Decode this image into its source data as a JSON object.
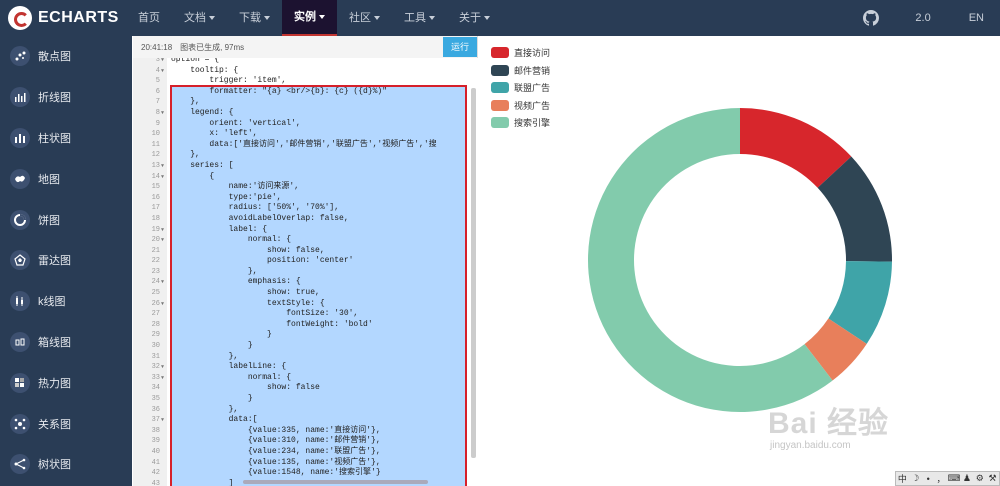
{
  "nav": {
    "logo_text": "ECHARTS",
    "items": [
      {
        "label": "首页",
        "caret": false,
        "active": false
      },
      {
        "label": "文档",
        "caret": true,
        "active": false
      },
      {
        "label": "下载",
        "caret": true,
        "active": false
      },
      {
        "label": "实例",
        "caret": true,
        "active": true
      },
      {
        "label": "社区",
        "caret": true,
        "active": false
      },
      {
        "label": "工具",
        "caret": true,
        "active": false
      },
      {
        "label": "关于",
        "caret": true,
        "active": false
      }
    ],
    "version": "2.0",
    "lang": "EN",
    "github_icon": "github-icon"
  },
  "sidebar": {
    "items": [
      {
        "label": "散点图",
        "icon": "scatter-icon"
      },
      {
        "label": "折线图",
        "icon": "line-chart-icon"
      },
      {
        "label": "柱状图",
        "icon": "bar-chart-icon"
      },
      {
        "label": "地图",
        "icon": "map-icon"
      },
      {
        "label": "饼图",
        "icon": "pie-icon"
      },
      {
        "label": "雷达图",
        "icon": "radar-icon"
      },
      {
        "label": "k线图",
        "icon": "candlestick-icon"
      },
      {
        "label": "箱线图",
        "icon": "boxplot-icon"
      },
      {
        "label": "热力图",
        "icon": "heatmap-icon"
      },
      {
        "label": "关系图",
        "icon": "graph-icon"
      },
      {
        "label": "树状图",
        "icon": "tree-icon"
      }
    ]
  },
  "editor": {
    "timestamp": "20:41:18",
    "status": "图表已生成, 97ms",
    "run_label": "运行",
    "lines": [
      {
        "n": "3",
        "fold": true,
        "text": "option = {"
      },
      {
        "n": "4",
        "fold": true,
        "text": "    tooltip: {"
      },
      {
        "n": "5",
        "fold": false,
        "text": "        trigger: 'item',"
      },
      {
        "n": "6",
        "fold": false,
        "text": "        formatter: \"{a} <br/>{b}: {c} ({d}%)\""
      },
      {
        "n": "7",
        "fold": false,
        "text": "    },"
      },
      {
        "n": "8",
        "fold": true,
        "text": "    legend: {"
      },
      {
        "n": "9",
        "fold": false,
        "text": "        orient: 'vertical',"
      },
      {
        "n": "10",
        "fold": false,
        "text": "        x: 'left',"
      },
      {
        "n": "11",
        "fold": false,
        "text": "        data:['直接访问','邮件营销','联盟广告','视频广告','搜"
      },
      {
        "n": "12",
        "fold": false,
        "text": "    },"
      },
      {
        "n": "13",
        "fold": true,
        "text": "    series: ["
      },
      {
        "n": "14",
        "fold": true,
        "text": "        {"
      },
      {
        "n": "15",
        "fold": false,
        "text": "            name:'访问来源',"
      },
      {
        "n": "16",
        "fold": false,
        "text": "            type:'pie',"
      },
      {
        "n": "17",
        "fold": false,
        "text": "            radius: ['50%', '70%'],"
      },
      {
        "n": "18",
        "fold": false,
        "text": "            avoidLabelOverlap: false,"
      },
      {
        "n": "19",
        "fold": true,
        "text": "            label: {"
      },
      {
        "n": "20",
        "fold": true,
        "text": "                normal: {"
      },
      {
        "n": "21",
        "fold": false,
        "text": "                    show: false,"
      },
      {
        "n": "22",
        "fold": false,
        "text": "                    position: 'center'"
      },
      {
        "n": "23",
        "fold": false,
        "text": "                },"
      },
      {
        "n": "24",
        "fold": true,
        "text": "                emphasis: {"
      },
      {
        "n": "25",
        "fold": false,
        "text": "                    show: true,"
      },
      {
        "n": "26",
        "fold": true,
        "text": "                    textStyle: {"
      },
      {
        "n": "27",
        "fold": false,
        "text": "                        fontSize: '30',"
      },
      {
        "n": "28",
        "fold": false,
        "text": "                        fontWeight: 'bold'"
      },
      {
        "n": "29",
        "fold": false,
        "text": "                    }"
      },
      {
        "n": "30",
        "fold": false,
        "text": "                }"
      },
      {
        "n": "31",
        "fold": false,
        "text": "            },"
      },
      {
        "n": "32",
        "fold": true,
        "text": "            labelLine: {"
      },
      {
        "n": "33",
        "fold": true,
        "text": "                normal: {"
      },
      {
        "n": "34",
        "fold": false,
        "text": "                    show: false"
      },
      {
        "n": "35",
        "fold": false,
        "text": "                }"
      },
      {
        "n": "36",
        "fold": false,
        "text": "            },"
      },
      {
        "n": "37",
        "fold": true,
        "text": "            data:["
      },
      {
        "n": "38",
        "fold": false,
        "text": "                {value:335, name:'直接访问'},"
      },
      {
        "n": "39",
        "fold": false,
        "text": "                {value:310, name:'邮件营销'},"
      },
      {
        "n": "40",
        "fold": false,
        "text": "                {value:234, name:'联盟广告'},"
      },
      {
        "n": "41",
        "fold": false,
        "text": "                {value:135, name:'视频广告'},"
      },
      {
        "n": "42",
        "fold": false,
        "text": "                {value:1548, name:'搜索引擎'}"
      },
      {
        "n": "43",
        "fold": false,
        "text": "            ]"
      },
      {
        "n": "44",
        "fold": false,
        "text": "        }"
      }
    ]
  },
  "chart_data": {
    "type": "pie",
    "donut": true,
    "categories": [
      "直接访问",
      "邮件营销",
      "联盟广告",
      "视频广告",
      "搜索引擎"
    ],
    "values": [
      335,
      310,
      234,
      135,
      1548
    ],
    "colors": [
      "#d7262c",
      "#2f4554",
      "#3fa4a8",
      "#e87f5b",
      "#82cbac"
    ],
    "legend_position": "top-left",
    "radius_inner_pct": 50,
    "radius_outer_pct": 70
  },
  "watermark": {
    "line1": "Bai 经验",
    "line2": "jingyan.baidu.com"
  },
  "ime": {
    "items": [
      "中",
      "☽",
      "•",
      "，",
      "⌨",
      "♟",
      "⚙",
      "⚒"
    ]
  }
}
